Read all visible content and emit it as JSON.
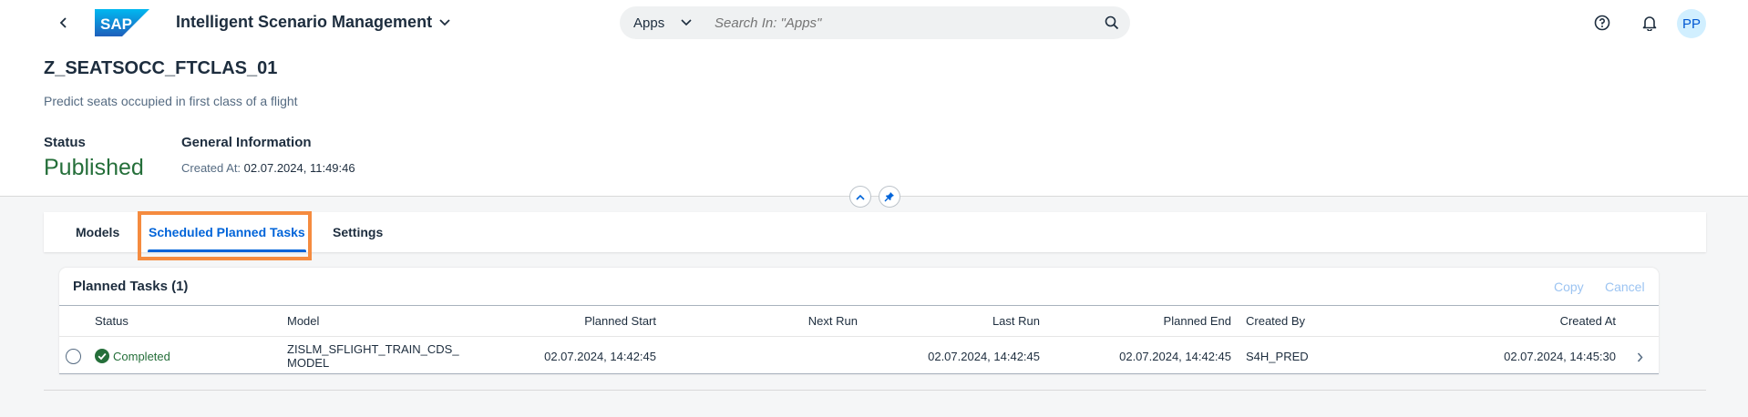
{
  "shell": {
    "logo_text": "SAP",
    "app_title": "Intelligent Scenario Management",
    "search_scope": "Apps",
    "search_placeholder": "Search In: \"Apps\"",
    "avatar_initials": "PP"
  },
  "header": {
    "title": "Z_SEATSOCC_FTCLAS_01",
    "subtitle": "Predict seats occupied in first class of a flight",
    "status_label": "Status",
    "status_value": "Published",
    "general_info_label": "General Information",
    "created_at_label": "Created At:",
    "created_at_value": "02.07.2024, 11:49:46"
  },
  "tabs": [
    {
      "label": "Models",
      "selected": false
    },
    {
      "label": "Scheduled Planned Tasks",
      "selected": true
    },
    {
      "label": "Settings",
      "selected": false
    }
  ],
  "table": {
    "title": "Planned Tasks (1)",
    "actions": {
      "copy": "Copy",
      "cancel": "Cancel"
    },
    "columns": [
      "Status",
      "Model",
      "Planned Start",
      "Next Run",
      "Last Run",
      "Planned End",
      "Created By",
      "Created At"
    ],
    "rows": [
      {
        "status": "Completed",
        "model_line1": "ZISLM_SFLIGHT_TRAIN_CDS_",
        "model_line2": "MODEL",
        "planned_start": "02.07.2024, 14:42:45",
        "next_run": "",
        "last_run": "02.07.2024, 14:42:45",
        "planned_end": "02.07.2024, 14:42:45",
        "created_by": "S4H_PRED",
        "created_at": "02.07.2024, 14:45:30"
      }
    ]
  },
  "colors": {
    "brand_blue": "#0064d9",
    "positive_green": "#256f3a",
    "highlight_orange": "#f58b3f"
  }
}
